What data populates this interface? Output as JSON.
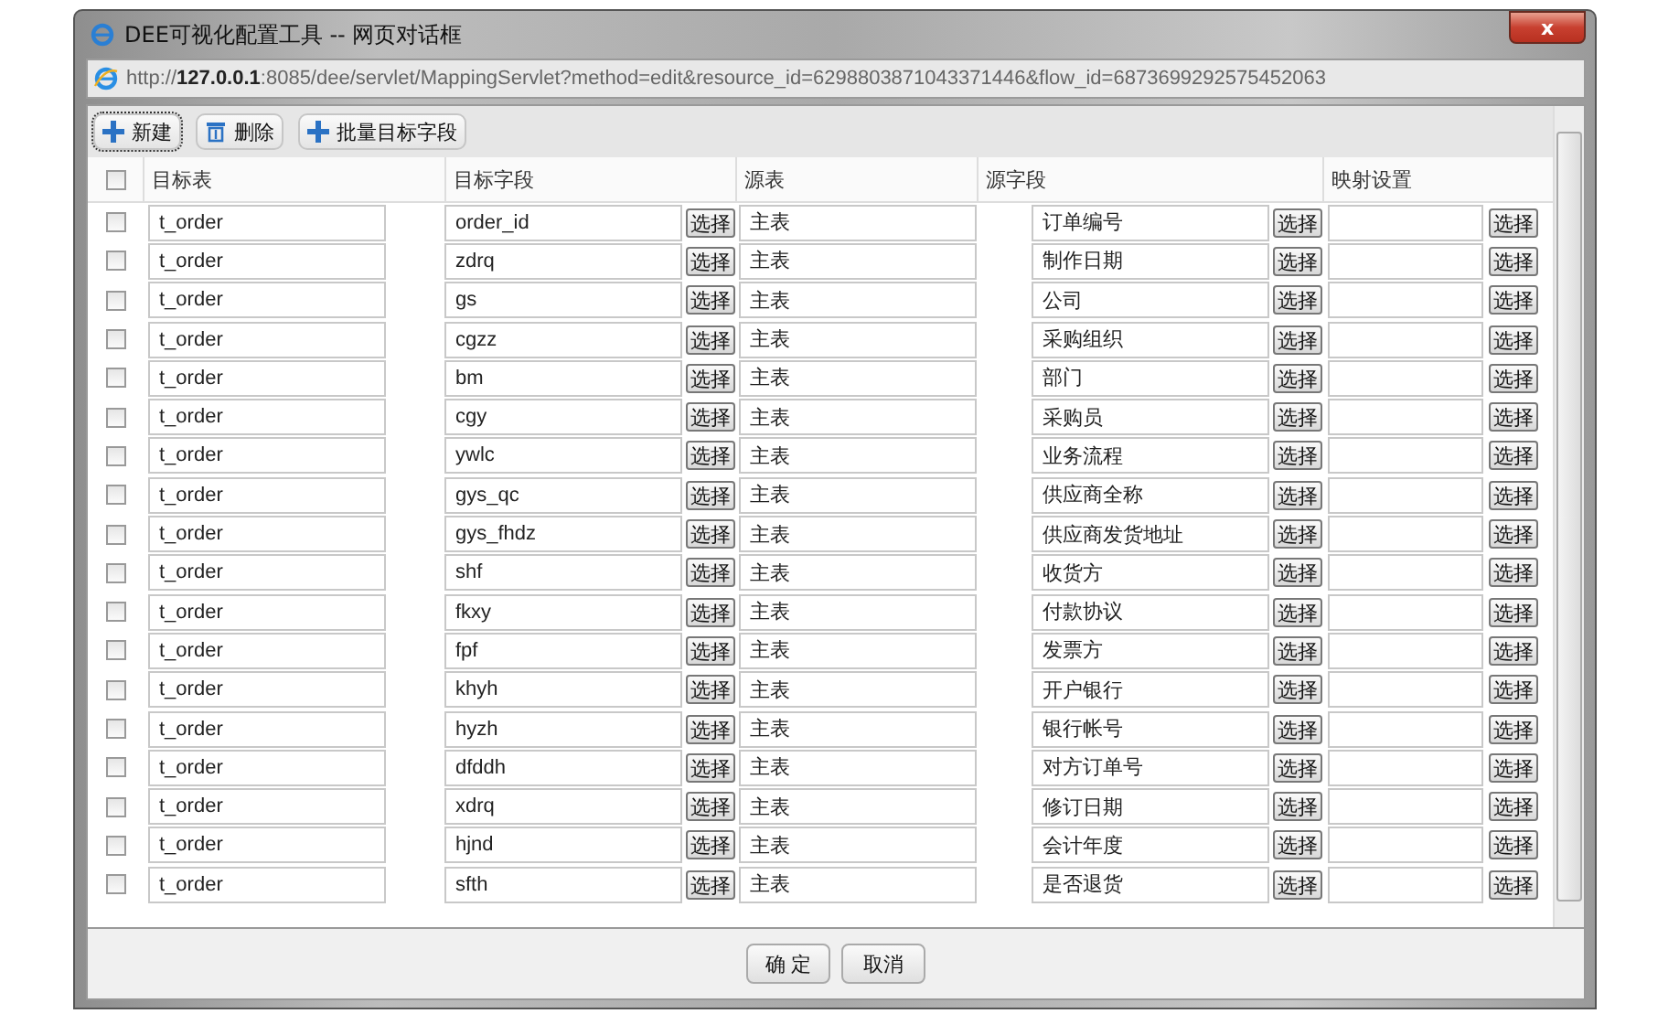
{
  "window": {
    "title": "DEE可视化配置工具 -- 网页对话框",
    "address": "http://**127.0.0.1**:8085/dee/servlet/MappingServlet?method=edit&resource_id=6298803871043371446&flow_id=6873699292575452063"
  },
  "toolbar": [
    {
      "label": "新建",
      "kind": "add"
    },
    {
      "label": "删除",
      "kind": "delete"
    },
    {
      "label": "批量目标字段",
      "kind": "add"
    }
  ],
  "table": {
    "columns": [
      "目标表",
      "目标字段",
      "源表",
      "源字段",
      "映射设置"
    ],
    "all_checked": false,
    "rows": [
      {
        "checked": false,
        "target_table": "t_order",
        "target_field": "order_id",
        "source_table": "主表",
        "source_field": "订单编号",
        "buttons": [
          "选择",
          "选择",
          "选择"
        ]
      },
      {
        "checked": false,
        "target_table": "t_order",
        "target_field": "zdrq",
        "source_table": "主表",
        "source_field": "制作日期",
        "buttons": [
          "选择",
          "选择",
          "选择"
        ]
      },
      {
        "checked": false,
        "target_table": "t_order",
        "target_field": "gs",
        "source_table": "主表",
        "source_field": "公司",
        "buttons": [
          "选择",
          "选择",
          "选择"
        ]
      },
      {
        "checked": false,
        "target_table": "t_order",
        "target_field": "cgzz",
        "source_table": "主表",
        "source_field": "采购组织",
        "buttons": [
          "选择",
          "选择",
          "选择"
        ]
      },
      {
        "checked": false,
        "target_table": "t_order",
        "target_field": "bm",
        "source_table": "主表",
        "source_field": "部门",
        "buttons": [
          "选择",
          "选择",
          "选择"
        ]
      },
      {
        "checked": false,
        "target_table": "t_order",
        "target_field": "cgy",
        "source_table": "主表",
        "source_field": "采购员",
        "buttons": [
          "选择",
          "选择",
          "选择"
        ]
      },
      {
        "checked": false,
        "target_table": "t_order",
        "target_field": "ywlc",
        "source_table": "主表",
        "source_field": "业务流程",
        "buttons": [
          "选择",
          "选择",
          "选择"
        ]
      },
      {
        "checked": false,
        "target_table": "t_order",
        "target_field": "gys_qc",
        "source_table": "主表",
        "source_field": "供应商全称",
        "buttons": [
          "选择",
          "选择",
          "选择"
        ]
      },
      {
        "checked": false,
        "target_table": "t_order",
        "target_field": "gys_fhdz",
        "source_table": "主表",
        "source_field": "供应商发货地址",
        "buttons": [
          "选择",
          "选择",
          "选择"
        ]
      },
      {
        "checked": false,
        "target_table": "t_order",
        "target_field": "shf",
        "source_table": "主表",
        "source_field": "收货方",
        "buttons": [
          "选择",
          "选择",
          "选择"
        ]
      },
      {
        "checked": false,
        "target_table": "t_order",
        "target_field": "fkxy",
        "source_table": "主表",
        "source_field": "付款协议",
        "buttons": [
          "选择",
          "选择",
          "选择"
        ]
      },
      {
        "checked": false,
        "target_table": "t_order",
        "target_field": "fpf",
        "source_table": "主表",
        "source_field": "发票方",
        "buttons": [
          "选择",
          "选择",
          "选择"
        ]
      },
      {
        "checked": false,
        "target_table": "t_order",
        "target_field": "khyh",
        "source_table": "主表",
        "source_field": "开户银行",
        "buttons": [
          "选择",
          "选择",
          "选择"
        ]
      },
      {
        "checked": false,
        "target_table": "t_order",
        "target_field": "hyzh",
        "source_table": "主表",
        "source_field": "银行帐号",
        "buttons": [
          "选择",
          "选择",
          "选择"
        ]
      },
      {
        "checked": false,
        "target_table": "t_order",
        "target_field": "dfddh",
        "source_table": "主表",
        "source_field": "对方订单号",
        "buttons": [
          "选择",
          "选择",
          "选择"
        ]
      },
      {
        "checked": false,
        "target_table": "t_order",
        "target_field": "xdrq",
        "source_table": "主表",
        "source_field": "修订日期",
        "buttons": [
          "选择",
          "选择",
          "选择"
        ]
      },
      {
        "checked": false,
        "target_table": "t_order",
        "target_field": "hjnd",
        "source_table": "主表",
        "source_field": "会计年度",
        "buttons": [
          "选择",
          "选择",
          "选择"
        ]
      },
      {
        "checked": false,
        "target_table": "t_order",
        "target_field": "sfth",
        "source_table": "主表",
        "source_field": "是否退货",
        "buttons": [
          "选择",
          "选择",
          "选择"
        ]
      }
    ]
  },
  "buttons": [
    "确 定",
    "取消"
  ],
  "close_label": "x"
}
